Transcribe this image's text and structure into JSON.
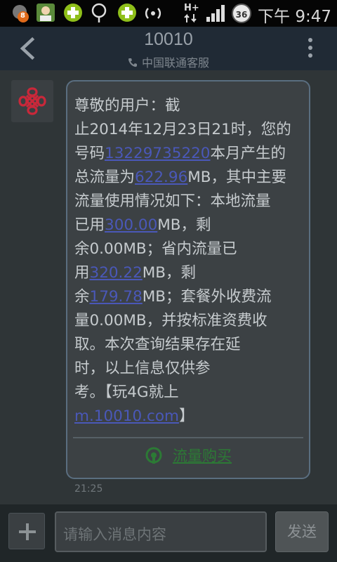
{
  "status_bar": {
    "notification_badge": "8",
    "network": "H+",
    "battery_badge": "36",
    "time": "下午 9:47"
  },
  "header": {
    "title": "10010",
    "subtitle": "中国联通客服"
  },
  "message": {
    "lines": [
      [
        {
          "t": "尊敬的用户：截"
        }
      ],
      [
        {
          "t": "止2014年12月23日21时，您的"
        }
      ],
      [
        {
          "t": "号码"
        },
        {
          "t": "13229735220",
          "link": true
        },
        {
          "t": "本月产生的"
        }
      ],
      [
        {
          "t": "总流量为"
        },
        {
          "t": "622.96",
          "link": true
        },
        {
          "t": "MB，其中主要"
        }
      ],
      [
        {
          "t": "流量使用情况如下：本地流量"
        }
      ],
      [
        {
          "t": "已用"
        },
        {
          "t": "300.00",
          "link": true
        },
        {
          "t": "MB，剩"
        }
      ],
      [
        {
          "t": "余0.00MB；省内流量已"
        }
      ],
      [
        {
          "t": "用"
        },
        {
          "t": "320.22",
          "link": true
        },
        {
          "t": "MB，剩"
        }
      ],
      [
        {
          "t": "余"
        },
        {
          "t": "179.78",
          "link": true
        },
        {
          "t": "MB；套餐外收费流"
        }
      ],
      [
        {
          "t": "量0.00MB，并按标准资费收"
        }
      ],
      [
        {
          "t": "取。本次查询结果存在延"
        }
      ],
      [
        {
          "t": "时，以上信息仅供参"
        }
      ],
      [
        {
          "t": "考。【玩4G就上"
        }
      ],
      [
        {
          "t": "m.10010.com",
          "link": true
        },
        {
          "t": "】"
        }
      ]
    ],
    "action_label": "流量购买",
    "timestamp": "21:25"
  },
  "composer": {
    "placeholder": "请输入消息内容",
    "send_label": "发送"
  },
  "colors": {
    "link": "#4a58b8",
    "action": "#2c7a35",
    "unicom_red": "#c9283a"
  }
}
